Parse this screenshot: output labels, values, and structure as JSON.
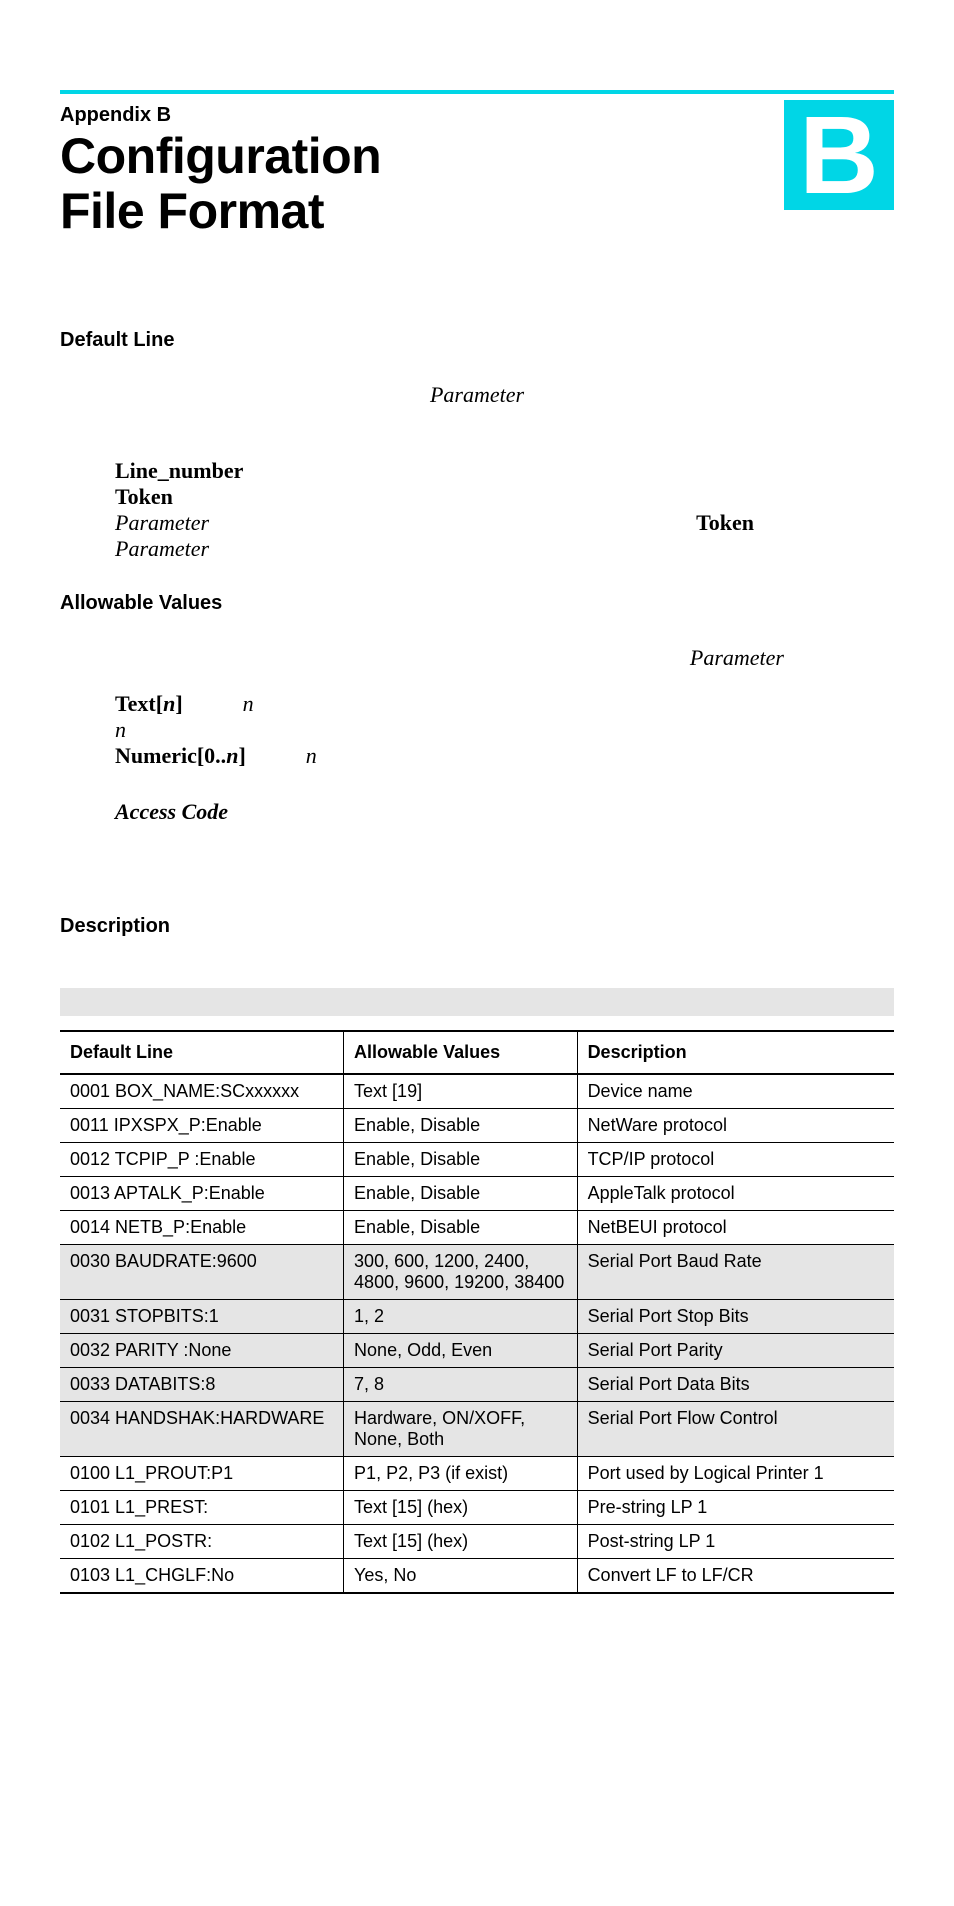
{
  "header": {
    "appendix_label": "Appendix B",
    "title_line1": "Configuration",
    "title_line2": "File Format",
    "big_letter": "B"
  },
  "sections": {
    "default_line_heading": "Default Line",
    "parameter_centered": "Parameter",
    "def_terms": {
      "line_number": "Line_number",
      "token": "Token",
      "parameter1": "Parameter",
      "parameter2": "Parameter",
      "right_token": "Token"
    },
    "allowable_heading": "Allowable Values",
    "right_parameter": "Parameter",
    "text_n_label_pre": "Text[",
    "text_n_label_post": "]",
    "n_var": "n",
    "numeric_label_pre": "Numeric[0..",
    "numeric_label_post": "]",
    "access_code": "Access Code",
    "description_heading": "Description"
  },
  "table": {
    "headers": [
      "Default Line",
      "Allowable Values",
      "Description"
    ],
    "rows": [
      {
        "shade": false,
        "c1": "0001 BOX_NAME:SCxxxxxx",
        "c2": "Text [19]",
        "c3": "Device name"
      },
      {
        "shade": false,
        "c1": "0011 IPXSPX_P:Enable",
        "c2": "Enable, Disable",
        "c3": "NetWare protocol"
      },
      {
        "shade": false,
        "c1": "0012 TCPIP_P :Enable",
        "c2": "Enable, Disable",
        "c3": "TCP/IP protocol"
      },
      {
        "shade": false,
        "c1": "0013 APTALK_P:Enable",
        "c2": "Enable, Disable",
        "c3": "AppleTalk protocol"
      },
      {
        "shade": false,
        "c1": "0014 NETB_P:Enable",
        "c2": "Enable, Disable",
        "c3": "NetBEUI protocol"
      },
      {
        "shade": true,
        "c1": "0030 BAUDRATE:9600",
        "c2": "300, 600, 1200, 2400, 4800, 9600, 19200, 38400",
        "c3": "Serial Port Baud Rate"
      },
      {
        "shade": true,
        "c1": "0031 STOPBITS:1",
        "c2": "1, 2",
        "c3": "Serial Port Stop Bits"
      },
      {
        "shade": true,
        "c1": "0032 PARITY :None",
        "c2": "None, Odd, Even",
        "c3": "Serial Port Parity"
      },
      {
        "shade": true,
        "c1": "0033 DATABITS:8",
        "c2": "7, 8",
        "c3": "Serial Port Data Bits"
      },
      {
        "shade": true,
        "c1": "0034 HANDSHAK:HARDWARE",
        "c2": "Hardware, ON/XOFF, None, Both",
        "c3": "Serial Port Flow Control"
      },
      {
        "shade": false,
        "c1": "0100 L1_PROUT:P1",
        "c2": "P1, P2, P3 (if exist)",
        "c3": "Port used by Logical Printer 1"
      },
      {
        "shade": false,
        "c1": "0101 L1_PREST:",
        "c2": "Text [15] (hex)",
        "c3": "Pre-string LP 1"
      },
      {
        "shade": false,
        "c1": "0102 L1_POSTR:",
        "c2": "Text [15] (hex)",
        "c3": "Post-string LP 1"
      },
      {
        "shade": false,
        "c1": "0103 L1_CHGLF:No",
        "c2": "Yes, No",
        "c3": "Convert LF to LF/CR"
      }
    ]
  }
}
